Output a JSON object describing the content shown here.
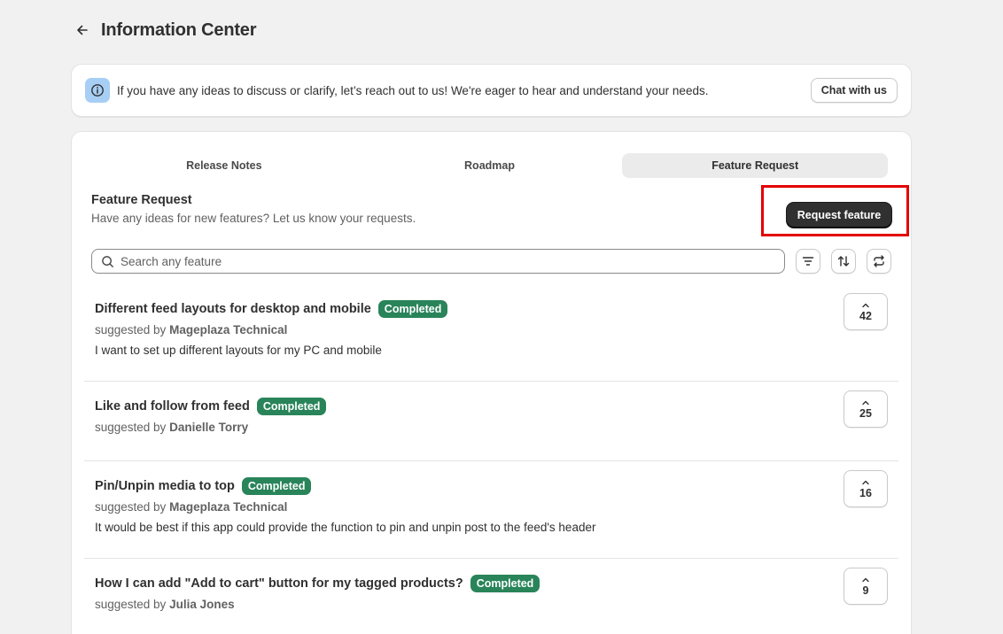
{
  "header": {
    "title": "Information Center"
  },
  "banner": {
    "text": "If you have any ideas to discuss or clarify, let’s reach out to us! We're eager to hear and understand your needs.",
    "chat_label": "Chat with us"
  },
  "tabs": [
    {
      "label": "Release Notes",
      "active": false
    },
    {
      "label": "Roadmap",
      "active": false
    },
    {
      "label": "Feature Request",
      "active": true
    }
  ],
  "section": {
    "title": "Feature Request",
    "subtitle": "Have any ideas for new features? Let us know your requests.",
    "request_label": "Request feature"
  },
  "search": {
    "placeholder": "Search any feature",
    "value": ""
  },
  "features": [
    {
      "title": "Different feed layouts for desktop and mobile",
      "status": "Completed",
      "suggested_prefix": "suggested by",
      "author": "Mageplaza Technical",
      "description": "I want to set up different layouts for my PC and mobile",
      "votes": "42"
    },
    {
      "title": "Like and follow from feed",
      "status": "Completed",
      "suggested_prefix": "suggested by",
      "author": "Danielle Torry",
      "description": "",
      "votes": "25"
    },
    {
      "title": "Pin/Unpin media to top",
      "status": "Completed",
      "suggested_prefix": "suggested by",
      "author": "Mageplaza Technical",
      "description": "It would be best if this app could provide the function to pin and unpin post to the feed's header",
      "votes": "16"
    },
    {
      "title": "How I can add \"Add to cart\" button for my tagged products?",
      "status": "Completed",
      "suggested_prefix": "suggested by",
      "author": "Julia Jones",
      "description": "",
      "votes": "9"
    }
  ],
  "colors": {
    "background": "#f1f1f1",
    "primary_button": "#303030",
    "badge_completed": "#29845a",
    "info_icon_bg": "#a7cff5",
    "highlight": "#e30000"
  },
  "icons": [
    "back-arrow-icon",
    "info-icon",
    "search-icon",
    "filter-icon",
    "sort-icon",
    "refresh-icon",
    "chevron-up-icon"
  ]
}
